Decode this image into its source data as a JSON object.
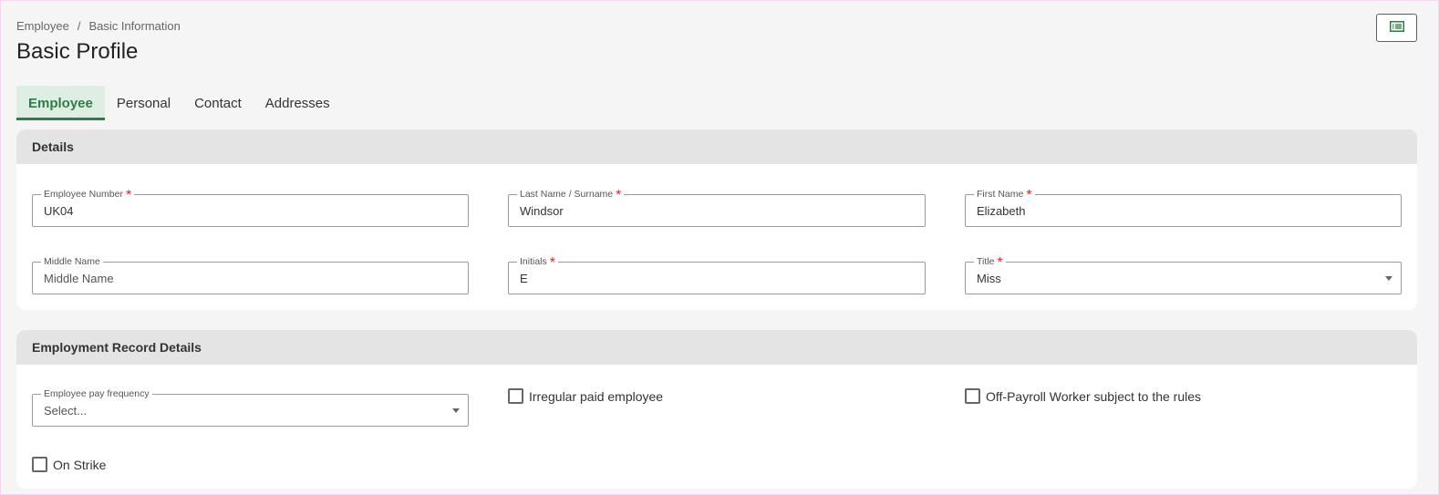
{
  "breadcrumb": {
    "parent": "Employee",
    "separator": "/",
    "current": "Basic Information"
  },
  "page_title": "Basic Profile",
  "toolbar": {
    "toggle_icon": "list-view-icon"
  },
  "tabs": [
    {
      "label": "Employee",
      "active": true
    },
    {
      "label": "Personal",
      "active": false
    },
    {
      "label": "Contact",
      "active": false
    },
    {
      "label": "Addresses",
      "active": false
    }
  ],
  "details": {
    "header": "Details",
    "employee_number": {
      "label": "Employee Number",
      "required": "*",
      "value": "UK04"
    },
    "last_name": {
      "label": "Last Name / Surname",
      "required": "*",
      "value": "Windsor"
    },
    "first_name": {
      "label": "First Name",
      "required": "*",
      "value": "Elizabeth"
    },
    "middle_name": {
      "label": "Middle Name",
      "placeholder": "Middle Name"
    },
    "initials": {
      "label": "Initials",
      "required": "*",
      "value": "E"
    },
    "title": {
      "label": "Title",
      "required": "*",
      "value": "Miss"
    }
  },
  "employment": {
    "header": "Employment Record Details",
    "pay_frequency": {
      "label": "Employee pay frequency",
      "placeholder": "Select..."
    },
    "irregular_paid": {
      "label": "Irregular paid employee",
      "checked": false
    },
    "off_payroll": {
      "label": "Off-Payroll Worker subject to the rules",
      "checked": false
    },
    "on_strike": {
      "label": "On Strike",
      "checked": false
    }
  },
  "colors": {
    "accent": "#2e7d47",
    "required": "#d32f2f",
    "header_bg": "#e4e4e4",
    "page_bg": "#f5f5f5"
  }
}
